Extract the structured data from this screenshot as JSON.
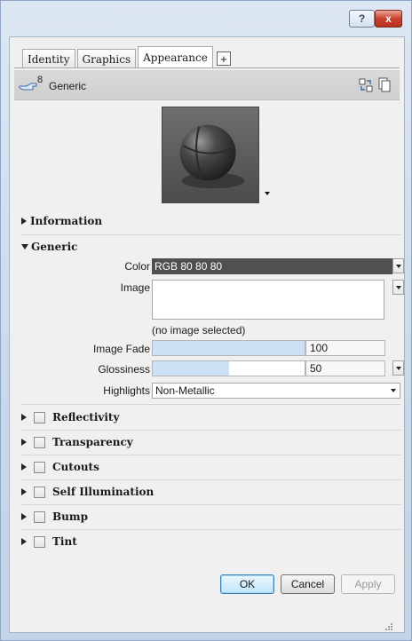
{
  "titlebar": {
    "help_label": "?",
    "close_label": "x"
  },
  "tabs": [
    {
      "label": "Identity"
    },
    {
      "label": "Graphics"
    },
    {
      "label": "Appearance"
    }
  ],
  "tab_add_label": "+",
  "asset": {
    "count": "8",
    "name": "Generic"
  },
  "sections": {
    "information": "Information",
    "generic": "Generic",
    "reflectivity": "Reflectivity",
    "transparency": "Transparency",
    "cutouts": "Cutouts",
    "self_illumination": "Self Illumination",
    "bump": "Bump",
    "tint": "Tint"
  },
  "generic": {
    "color_label": "Color",
    "color_value": "RGB 80 80 80",
    "image_label": "Image",
    "no_image_text": "(no image selected)",
    "image_fade_label": "Image Fade",
    "image_fade_value": "100",
    "image_fade_fraction": 1.0,
    "glossiness_label": "Glossiness",
    "glossiness_value": "50",
    "glossiness_fraction": 0.5,
    "highlights_label": "Highlights",
    "highlights_value": "Non-Metallic"
  },
  "buttons": {
    "ok": "OK",
    "cancel": "Cancel",
    "apply": "Apply"
  },
  "colors": {
    "color_swatch": "#505050",
    "slider_fill": "#cde1f5"
  }
}
